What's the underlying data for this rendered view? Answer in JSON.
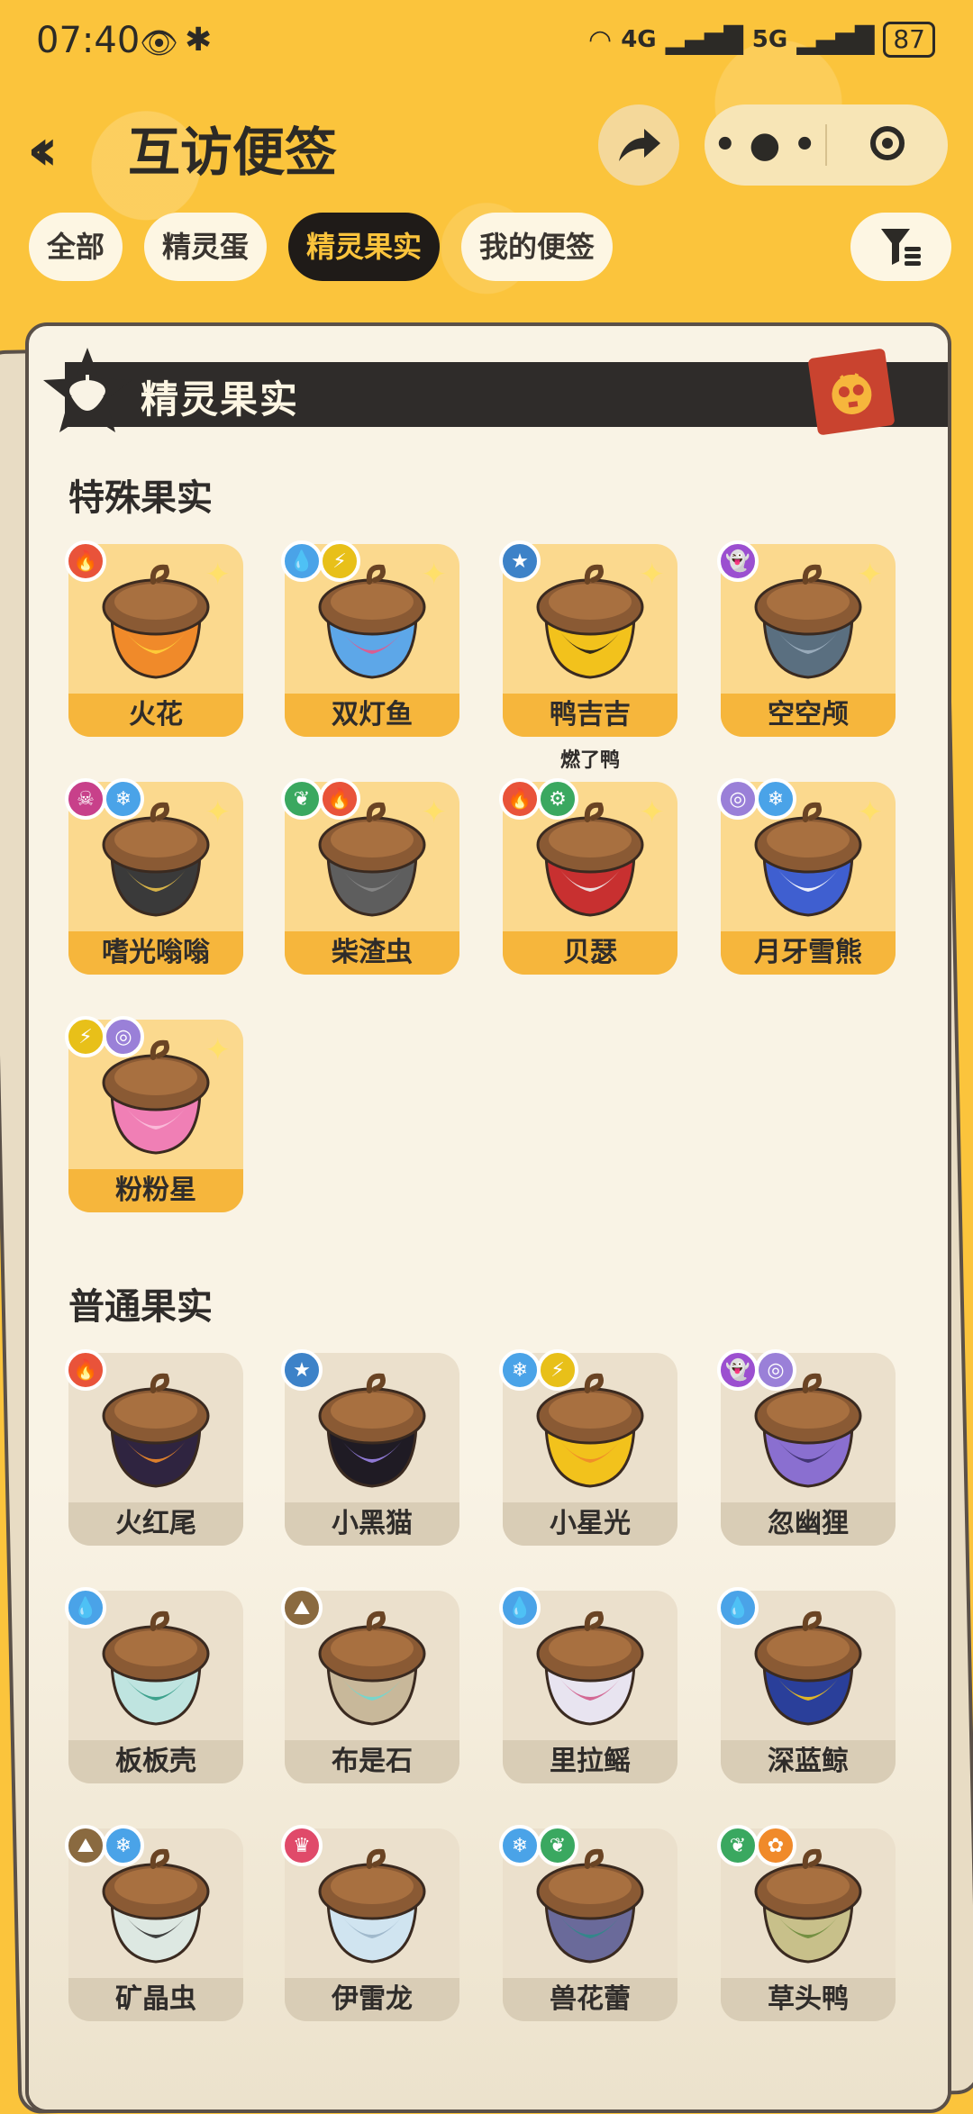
{
  "status": {
    "time": "07:40",
    "network_a": "4G",
    "network_b": "5G",
    "battery": "87"
  },
  "header": {
    "title": "互访便签"
  },
  "tabs": [
    {
      "label": "全部"
    },
    {
      "label": "精灵蛋"
    },
    {
      "label": "精灵果实",
      "active": true
    },
    {
      "label": "我的便签"
    }
  ],
  "banner": {
    "title": "精灵果实"
  },
  "special": {
    "title": "特殊果实",
    "items": [
      {
        "name": "火花",
        "badges": [
          "fire"
        ],
        "colors": [
          "#f08a2a",
          "#ffd23a"
        ]
      },
      {
        "name": "双灯鱼",
        "badges": [
          "water",
          "electric"
        ],
        "colors": [
          "#5da7e8",
          "#e5578a"
        ]
      },
      {
        "name": "鸭吉吉",
        "badges": [
          "normal"
        ],
        "colors": [
          "#f2c21c",
          "#1f1b18"
        ],
        "note": "燃了鸭"
      },
      {
        "name": "空空颅",
        "badges": [
          "ghost"
        ],
        "colors": [
          "#5a6f80",
          "#9fb0c0"
        ]
      },
      {
        "name": "嗜光嗡嗡",
        "badges": [
          "poison",
          "ice"
        ],
        "colors": [
          "#3a3a3a",
          "#e8c04a"
        ]
      },
      {
        "name": "柴渣虫",
        "badges": [
          "grass",
          "fire"
        ],
        "colors": [
          "#5e5e5e",
          "#8a8a8a"
        ]
      },
      {
        "name": "贝瑟",
        "badges": [
          "fire",
          "mech"
        ],
        "colors": [
          "#c83030",
          "#f1f1f1"
        ]
      },
      {
        "name": "月牙雪熊",
        "badges": [
          "psychic",
          "ice"
        ],
        "colors": [
          "#3f5fd0",
          "#ffffff"
        ]
      },
      {
        "name": "粉粉星",
        "badges": [
          "electric",
          "psychic"
        ],
        "colors": [
          "#f07fb5",
          "#fbc0dc"
        ]
      }
    ]
  },
  "normal": {
    "title": "普通果实",
    "items": [
      {
        "name": "火红尾",
        "badges": [
          "fire"
        ],
        "colors": [
          "#2f2440",
          "#f08a2a"
        ]
      },
      {
        "name": "小黑猫",
        "badges": [
          "normal"
        ],
        "colors": [
          "#1f1b24",
          "#9b84e8"
        ]
      },
      {
        "name": "小星光",
        "badges": [
          "ice",
          "electric"
        ],
        "colors": [
          "#f2c21c",
          "#f08a2a"
        ]
      },
      {
        "name": "忽幽狸",
        "badges": [
          "ghost",
          "psychic"
        ],
        "colors": [
          "#8a6fd0",
          "#3a2f6a"
        ]
      },
      {
        "name": "板板壳",
        "badges": [
          "water"
        ],
        "colors": [
          "#bfe4e0",
          "#2f9a84"
        ]
      },
      {
        "name": "布是石",
        "badges": [
          "ground"
        ],
        "colors": [
          "#c8b89a",
          "#6fd8d0"
        ]
      },
      {
        "name": "里拉鳐",
        "badges": [
          "water"
        ],
        "colors": [
          "#e8e4f0",
          "#d05a8a"
        ]
      },
      {
        "name": "深蓝鲸",
        "badges": [
          "water"
        ],
        "colors": [
          "#2a3f9a",
          "#f2c21c"
        ]
      },
      {
        "name": "矿晶虫",
        "badges": [
          "ground",
          "ice"
        ],
        "colors": [
          "#dde8e2",
          "#2f2f2f"
        ]
      },
      {
        "name": "伊雷龙",
        "badges": [
          "dragon"
        ],
        "colors": [
          "#d0e4f0",
          "#9ab4c8"
        ]
      },
      {
        "name": "兽花蕾",
        "badges": [
          "ice",
          "grass"
        ],
        "colors": [
          "#6a6a9a",
          "#2f8a8a"
        ]
      },
      {
        "name": "草头鸭",
        "badges": [
          "grass",
          "bug"
        ],
        "colors": [
          "#c8c08a",
          "#6a8a3a"
        ]
      }
    ]
  },
  "badge_colors": {
    "fire": "#e9533a",
    "water": "#4aa3e8",
    "electric": "#e8c019",
    "normal": "#3d82c8",
    "ghost": "#9b4fd0",
    "poison": "#c8408a",
    "ice": "#4aa3e8",
    "grass": "#3aa860",
    "mech": "#3aa860",
    "psychic": "#9a80d8",
    "ground": "#8a6a40",
    "dragon": "#e04a6a",
    "bug": "#f08a2a"
  },
  "badge_glyphs": {
    "fire": "🔥",
    "water": "💧",
    "electric": "⚡",
    "normal": "★",
    "ghost": "👻",
    "poison": "☠",
    "ice": "❄",
    "grass": "❦",
    "mech": "⚙",
    "psychic": "◎",
    "ground": "⛰",
    "dragon": "♛",
    "bug": "✿"
  }
}
